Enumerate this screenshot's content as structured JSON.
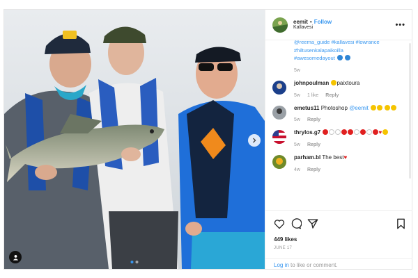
{
  "post": {
    "username": "eemit",
    "follow_label": "Follow",
    "separator": "•",
    "location": "Kallavesi",
    "more_label": "•••"
  },
  "caption": {
    "line1": "@reema_guide #kallavesi #lowrance",
    "line2": "#hiltusenkalapaikoilla",
    "line3": "#awesomedayout",
    "time": "5w"
  },
  "comments": [
    {
      "user": "johnpoulman",
      "pre_text": "",
      "mention": "",
      "text": "paixtoura",
      "time": "5w",
      "likes": "1 like",
      "reply": "Reply"
    },
    {
      "user": "emetus11",
      "pre_text": "Photoshop ",
      "mention": "@eemit",
      "text": "",
      "time": "5w",
      "likes": "",
      "reply": "Reply"
    },
    {
      "user": "thrylos.g7",
      "pre_text": "",
      "mention": "",
      "text": "",
      "time": "5w",
      "likes": "",
      "reply": "Reply"
    },
    {
      "user": "parham.bl",
      "pre_text": "",
      "mention": "",
      "text": "The best",
      "time": "4w",
      "likes": "",
      "reply": "Reply"
    }
  ],
  "stats": {
    "likes": "449 likes",
    "date": "JUNE 17"
  },
  "login": {
    "link": "Log in",
    "rest": " to like or comment."
  },
  "icons": {
    "like": "heart-icon",
    "comment": "comment-icon",
    "share": "share-icon",
    "save": "bookmark-icon",
    "next": "chevron-right-icon",
    "tag": "user-tag-icon"
  },
  "colors": {
    "link": "#3897f0",
    "muted": "#999999",
    "text": "#262626",
    "border": "#efefef"
  }
}
